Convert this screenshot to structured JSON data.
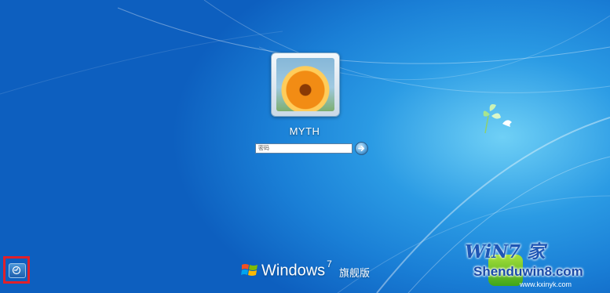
{
  "user": {
    "name": "MYTH",
    "avatar_icon": "flower-avatar-icon"
  },
  "login": {
    "password_placeholder": "密码",
    "submit_icon": "arrow-right-icon"
  },
  "ease_of_access": {
    "icon": "ease-of-access-icon",
    "highlight_color": "#e0202a"
  },
  "branding": {
    "product": "Windows",
    "version": "7",
    "edition": "旗舰版",
    "logo_icon": "windows-flag-icon"
  },
  "watermark": {
    "logo_text": "WiN7 家",
    "site": "Shenduwin8.com",
    "url": "www.kxinyk.com"
  },
  "colors": {
    "background": "#1a7fd6",
    "highlight": "#6fd0f6",
    "text": "#ffffff"
  }
}
